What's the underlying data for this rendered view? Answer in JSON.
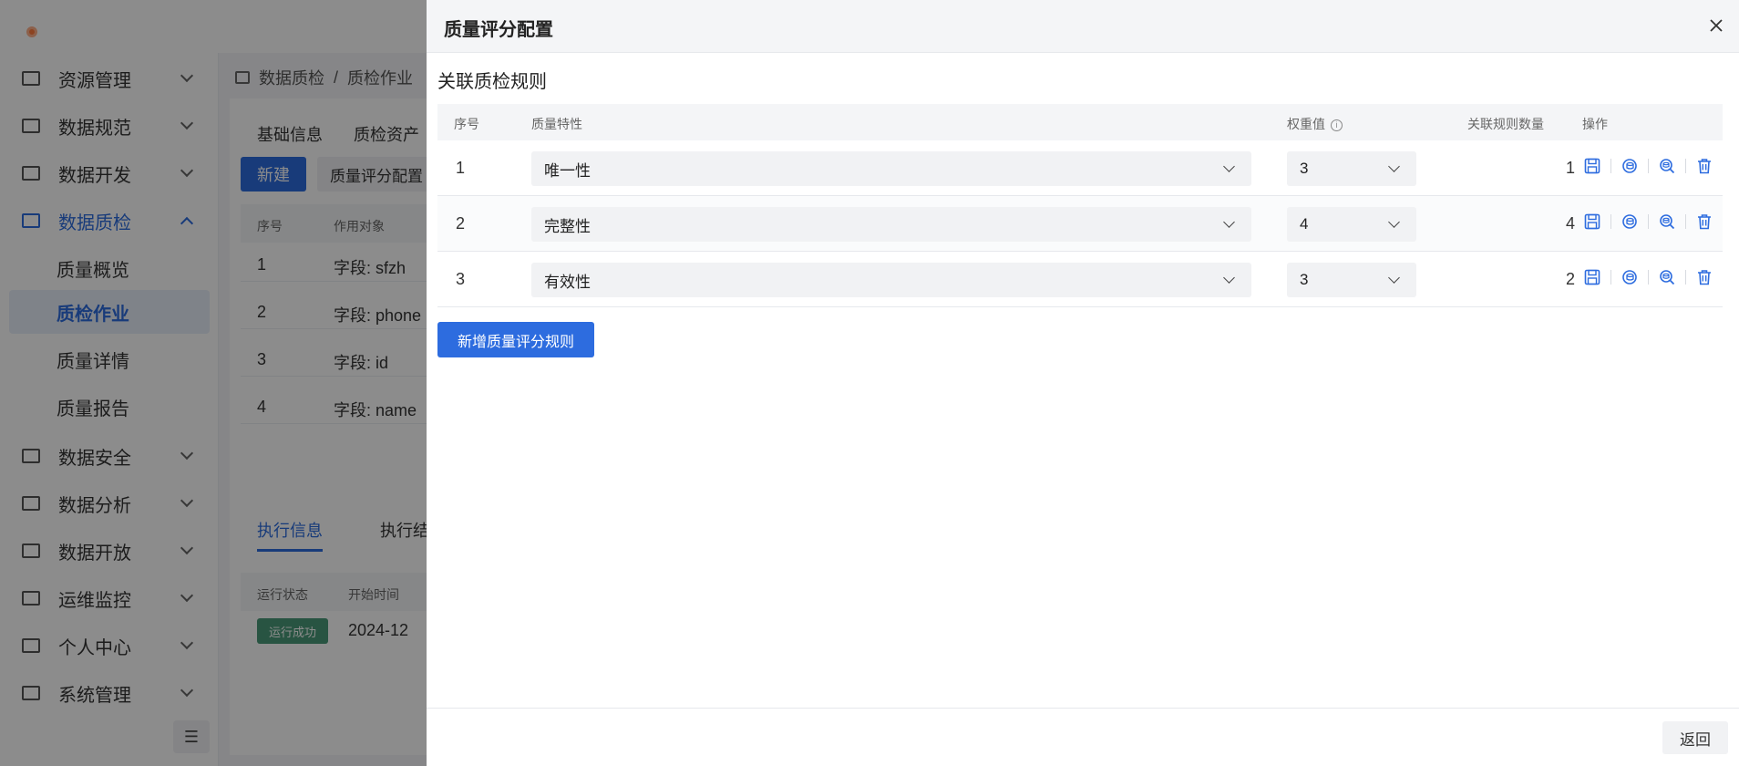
{
  "sidebar": {
    "groups": [
      {
        "label": "资源管理"
      },
      {
        "label": "数据规范"
      },
      {
        "label": "数据开发"
      },
      {
        "label": "数据质检"
      },
      {
        "label": "数据安全"
      },
      {
        "label": "数据分析"
      },
      {
        "label": "数据开放"
      },
      {
        "label": "运维监控"
      },
      {
        "label": "个人中心"
      },
      {
        "label": "系统管理"
      }
    ],
    "sub_items": [
      {
        "label": "质量概览"
      },
      {
        "label": "质检作业"
      },
      {
        "label": "质量详情"
      },
      {
        "label": "质量报告"
      }
    ]
  },
  "background": {
    "breadcrumb": [
      "数据质检",
      "/",
      "质检作业"
    ],
    "tabs": [
      "基础信息",
      "质检资产"
    ],
    "new_button": "新建",
    "config_button": "质量评分配置",
    "table_headers": [
      "序号",
      "作用对象"
    ],
    "rows": [
      {
        "no": "1",
        "target": "字段: sfzh"
      },
      {
        "no": "2",
        "target": "字段: phone"
      },
      {
        "no": "3",
        "target": "字段: id"
      },
      {
        "no": "4",
        "target": "字段: name"
      }
    ],
    "exec_tabs": [
      "执行信息",
      "执行结"
    ],
    "exec_headers": [
      "运行状态",
      "开始时间"
    ],
    "exec_status": "运行成功",
    "exec_start": "2024-12"
  },
  "drawer": {
    "title": "质量评分配置",
    "section_title": "关联质检规则",
    "columns": {
      "no": "序号",
      "property": "质量特性",
      "weight": "权重值",
      "rule_count": "关联规则数量",
      "actions": "操作"
    },
    "rows": [
      {
        "no": "1",
        "property": "唯一性",
        "weight": "3",
        "rule_count": "1"
      },
      {
        "no": "2",
        "property": "完整性",
        "weight": "4",
        "rule_count": "4"
      },
      {
        "no": "3",
        "property": "有效性",
        "weight": "3",
        "rule_count": "2"
      }
    ],
    "add_button": "新增质量评分规则",
    "back_button": "返回"
  },
  "colors": {
    "primary": "#2d6cdf",
    "success": "#4a9a78",
    "overlay": "rgba(0,0,0,0.45)"
  }
}
